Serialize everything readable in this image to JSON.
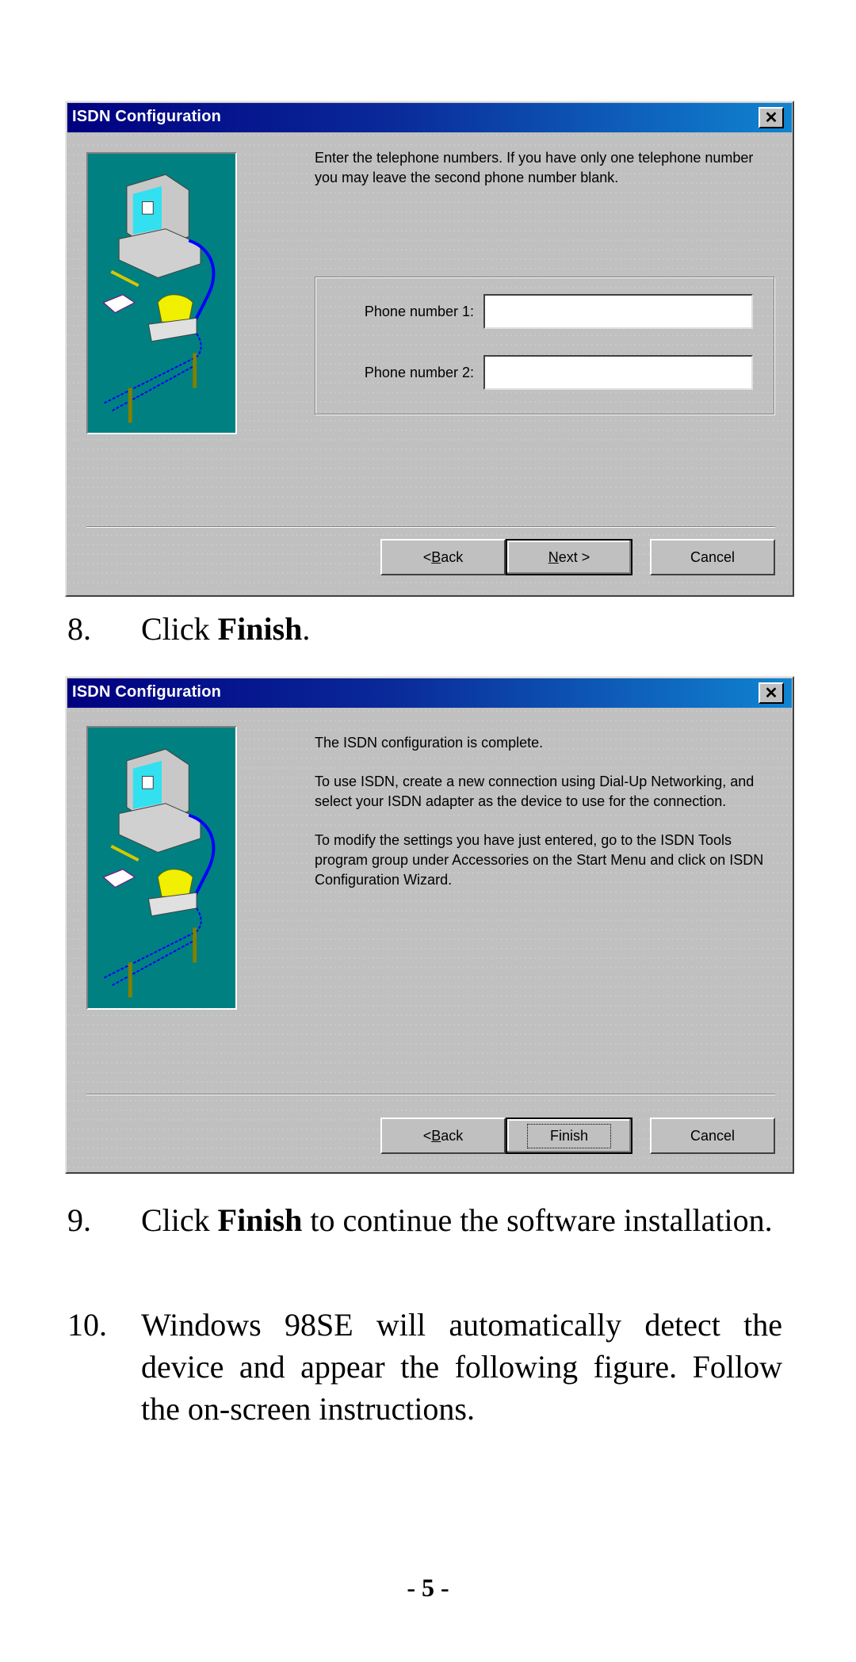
{
  "dialog1": {
    "title": "ISDN Configuration",
    "close_icon": "close-icon",
    "illustration": "computer-phone-network-illustration",
    "instruction": "Enter the telephone numbers.  If you have only one telephone number you may leave the second phone number blank.",
    "fields": [
      {
        "label": "Phone number 1:",
        "value": ""
      },
      {
        "label": "Phone number 2:",
        "value": ""
      }
    ],
    "buttons": {
      "back": {
        "prefix": "< ",
        "mnemonic": "B",
        "rest": "ack"
      },
      "next": {
        "mnemonic": "N",
        "rest": "ext >"
      },
      "cancel": "Cancel"
    }
  },
  "step8": {
    "number": "8.",
    "text_before": "Click ",
    "bold": "Finish",
    "text_after": "."
  },
  "dialog2": {
    "title": "ISDN Configuration",
    "close_icon": "close-icon",
    "illustration": "computer-phone-network-illustration",
    "paragraphs": [
      "The ISDN configuration is complete.",
      "To use ISDN, create a new connection using Dial-Up Networking, and select your ISDN adapter as the device to use for the connection.",
      "To modify the settings you have just entered, go to the ISDN Tools program group under Accessories on the Start Menu and click on ISDN Configuration Wizard."
    ],
    "buttons": {
      "back": {
        "prefix": "< ",
        "mnemonic": "B",
        "rest": "ack"
      },
      "finish": "Finish",
      "cancel": "Cancel"
    }
  },
  "step9": {
    "number": "9.",
    "text_before": "Click ",
    "bold": "Finish",
    "text_after": " to continue the software installation."
  },
  "step10": {
    "number": "10.",
    "text": "Windows 98SE will automatically detect the device and appear the following figure. Follow the on-screen instructions."
  },
  "page_number": "- 5 -",
  "colors": {
    "titlebar_start": "#000080",
    "titlebar_end": "#1084d0",
    "dialog_bg": "#c0c0c0",
    "art_bg": "#008080"
  }
}
